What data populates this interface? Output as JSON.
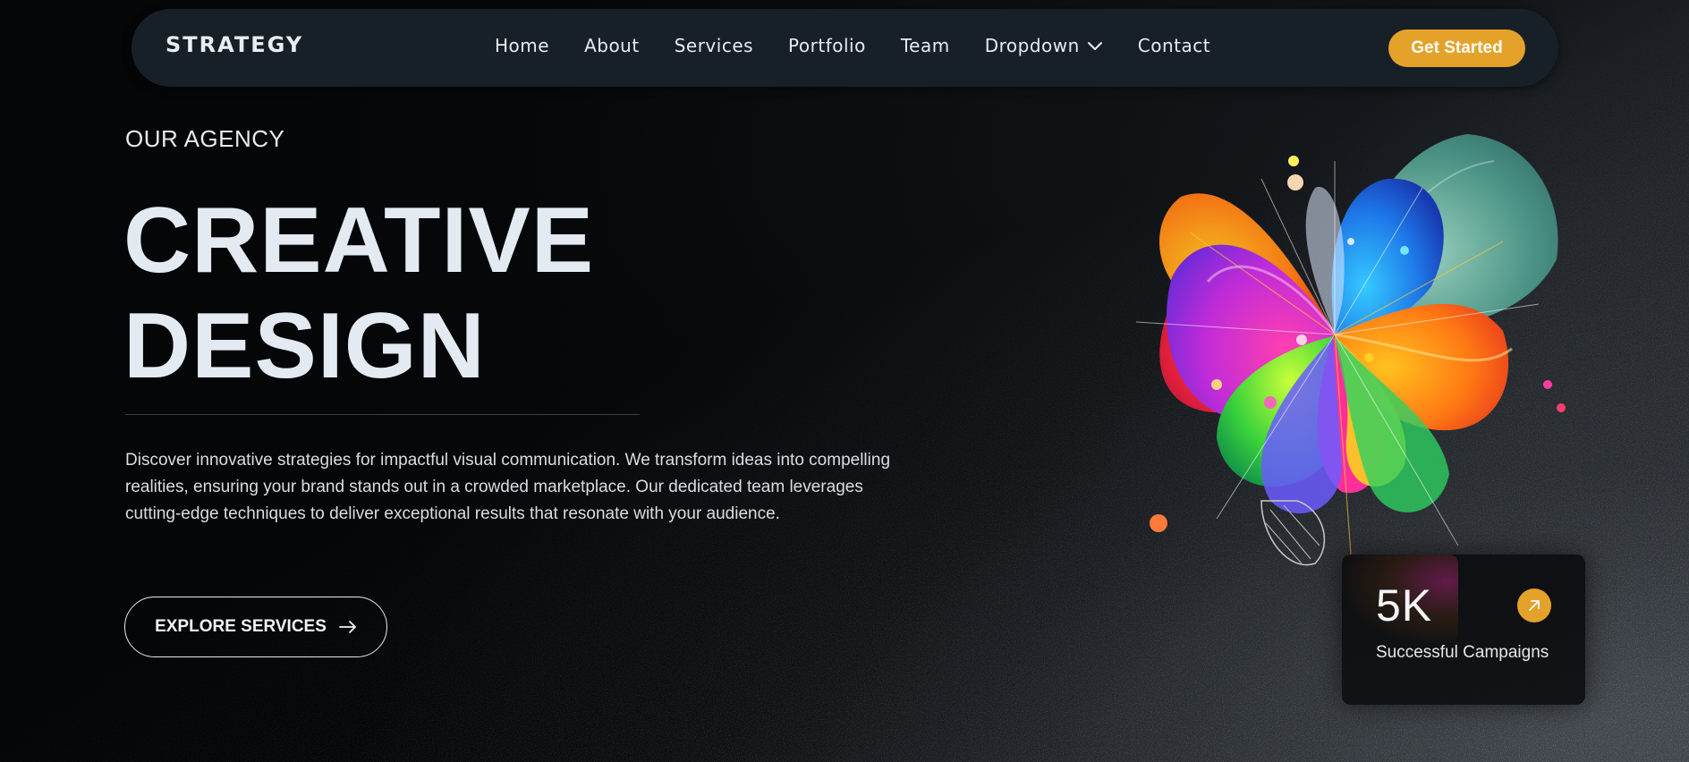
{
  "header": {
    "logo": "STRATEGY",
    "nav": [
      "Home",
      "About",
      "Services",
      "Portfolio",
      "Team",
      "Dropdown",
      "Contact"
    ],
    "cta_label": "Get Started"
  },
  "hero": {
    "eyebrow": "OUR AGENCY",
    "headline_line1": "CREATIVE",
    "headline_line2": "DESIGN",
    "description": "Discover innovative strategies for impactful visual communication. We transform ideas into compelling realities, ensuring your brand stands out in a crowded marketplace. Our dedicated team leverages cutting-edge techniques to deliver exceptional results that resonate with your audience.",
    "button_label": "EXPLORE SERVICES"
  },
  "stat": {
    "value": "5K",
    "label": "Successful Campaigns"
  },
  "icons": {
    "dropdown": "chevron-down-icon",
    "explore": "arrow-right-icon",
    "stat": "arrow-up-right-icon"
  },
  "colors": {
    "accent": "#e5a22a",
    "header_bg": "#172026",
    "page_bg": "#050607",
    "text": "#e4eaf2"
  }
}
